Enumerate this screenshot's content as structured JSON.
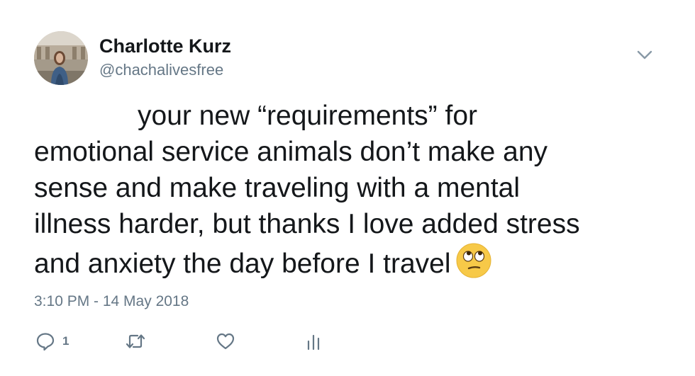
{
  "author": {
    "display_name": "Charlotte Kurz",
    "handle": "@chachalivesfree"
  },
  "tweet": {
    "text_lines": [
      "your new “requirements” for",
      "emotional service animals don’t make any",
      "sense and make traveling with a mental",
      "illness harder, but thanks I love added stress",
      "and anxiety the day before I travel"
    ],
    "emoji": "face-with-rolling-eyes",
    "timestamp": "3:10 PM - 14 May 2018"
  },
  "actions": {
    "reply_count": "1",
    "icons": [
      "reply-icon",
      "retweet-icon",
      "like-icon",
      "analytics-icon"
    ]
  },
  "colors": {
    "text": "#14171a",
    "secondary": "#657786"
  }
}
